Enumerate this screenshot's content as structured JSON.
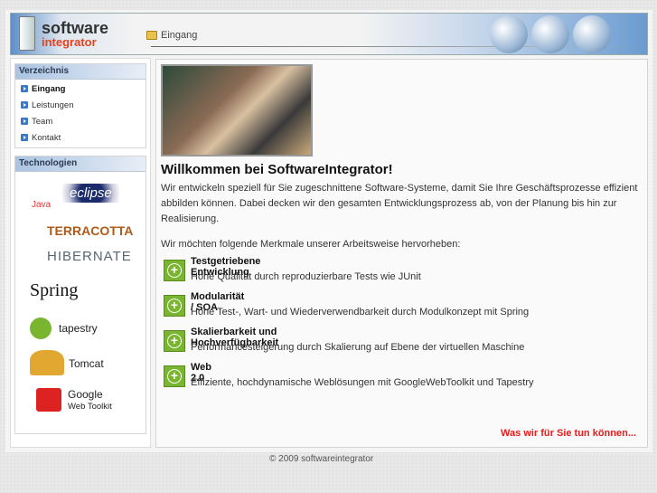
{
  "header": {
    "logo_line1": "software",
    "logo_line2": "integrator",
    "breadcrumb": "Eingang"
  },
  "sidebar": {
    "nav_title": "Verzeichnis",
    "nav_items": [
      {
        "label": "Eingang",
        "active": true
      },
      {
        "label": "Leistungen"
      },
      {
        "label": "Team"
      },
      {
        "label": "Kontakt"
      }
    ],
    "tech_title": "Technologien",
    "tech": [
      "Java",
      "eclipse",
      "TERRACOTTA",
      "HIBERNATE",
      "Spring",
      "tapestry",
      "Tomcat",
      "Google",
      "Web Toolkit"
    ]
  },
  "main": {
    "title": "Willkommen bei SoftwareIntegrator!",
    "intro": "Wir entwickeln speziell für Sie zugeschnittene Software-Systeme, damit Sie Ihre Geschäftsprozesse effizient abbilden können. Dabei decken wir den gesamten Entwicklungsprozess ab, von der Planung bis hin zur Realisierung.",
    "lead": "Wir möchten folgende Merkmale unserer Arbeitsweise hervorheben:",
    "features": [
      {
        "title": "Testgetriebene Entwicklung",
        "desc": "Hohe Qualität durch reproduzierbare Tests wie JUnit"
      },
      {
        "title": "Modularität / SOA",
        "desc": "Hohe Test-, Wart- und Wiederverwendbarkeit durch Modulkonzept mit Spring"
      },
      {
        "title": "Skalierbarkeit und Hochverfügbarkeit",
        "desc": "Performancesteigerung durch Skalierung auf Ebene der virtuellen Maschine"
      },
      {
        "title": "Web 2.0",
        "desc": "Effiziente, hochdynamische Weblösungen mit GoogleWebToolkit und Tapestry"
      }
    ],
    "more_link": "Was wir für Sie tun können..."
  },
  "footer": "© 2009 softwareintegrator",
  "colors": {
    "accent": "#f01818",
    "logo_red": "#e8401c",
    "green": "#7ab530"
  }
}
